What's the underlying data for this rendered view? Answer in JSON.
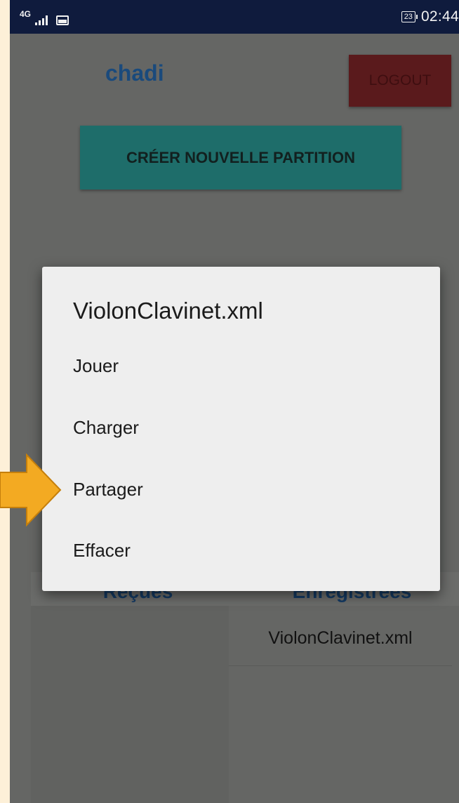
{
  "status_bar": {
    "network": "4G",
    "battery": "23",
    "time": "02:44"
  },
  "header": {
    "username": "chadi",
    "logout_label": "LOGOUT"
  },
  "main": {
    "create_button_label": "CRÉER NOUVELLE PARTITION"
  },
  "tabs": [
    {
      "label": "Reçues"
    },
    {
      "label": "Enregistrées"
    }
  ],
  "saved_files": [
    {
      "name": "ViolonClavinet.xml"
    }
  ],
  "dialog": {
    "title": "ViolonClavinet.xml",
    "items": [
      {
        "label": "Jouer"
      },
      {
        "label": "Charger"
      },
      {
        "label": "Partager"
      },
      {
        "label": "Effacer"
      }
    ]
  },
  "annotation": {
    "arrow_color": "#f3aa22",
    "points_to": "Partager"
  }
}
